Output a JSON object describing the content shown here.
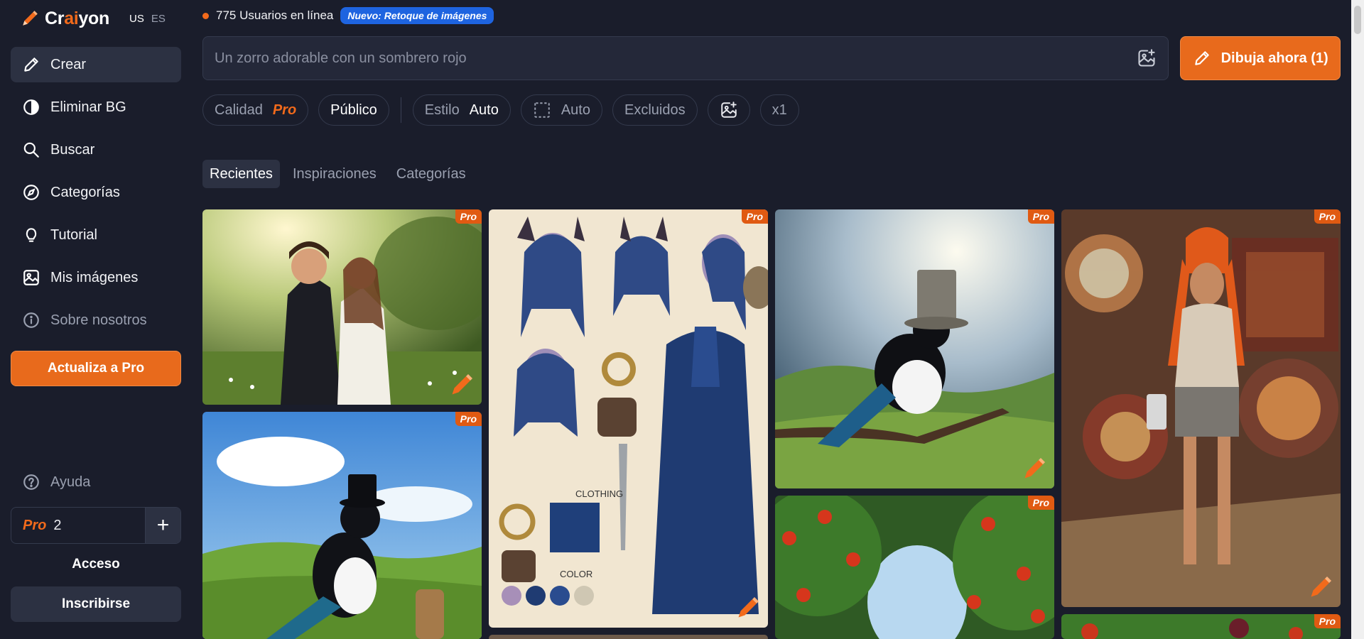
{
  "brand": {
    "prefix": "Cr",
    "accent": "ai",
    "suffix": "yon",
    "lang_active": "US",
    "lang_other": "ES"
  },
  "sidebar": {
    "items": [
      {
        "label": "Crear",
        "icon": "pencil-icon"
      },
      {
        "label": "Eliminar BG",
        "icon": "contrast-icon"
      },
      {
        "label": "Buscar",
        "icon": "search-icon"
      },
      {
        "label": "Categorías",
        "icon": "compass-icon"
      },
      {
        "label": "Tutorial",
        "icon": "lightbulb-icon"
      },
      {
        "label": "Mis imágenes",
        "icon": "image-icon"
      },
      {
        "label": "Sobre nosotros",
        "icon": "info-icon"
      }
    ],
    "upgrade_label": "Actualiza a Pro",
    "help_label": "Ayuda",
    "credits": {
      "pro_label": "Pro",
      "count": "2",
      "plus": "+"
    },
    "login_label": "Acceso",
    "signup_label": "Inscribirse"
  },
  "status": {
    "users_online": "775 Usuarios en línea",
    "badge": "Nuevo: Retoque de imágenes"
  },
  "prompt": {
    "placeholder": "Un zorro adorable con un sombrero rojo",
    "draw_label": "Dibuja ahora (1)"
  },
  "options": {
    "quality_label": "Calidad",
    "quality_value": "Pro",
    "visibility": "Público",
    "style_label": "Estilo",
    "style_value": "Auto",
    "ratio_value": "Auto",
    "excluded": "Excluidos",
    "count": "x1"
  },
  "tabs": [
    "Recientes",
    "Inspiraciones",
    "Categorías"
  ],
  "gallery": {
    "badge": "Pro"
  },
  "colors": {
    "accent": "#e86a1c",
    "bg": "#1a1d2b",
    "panel": "#2c3142",
    "badge_blue": "#1e64e0"
  }
}
